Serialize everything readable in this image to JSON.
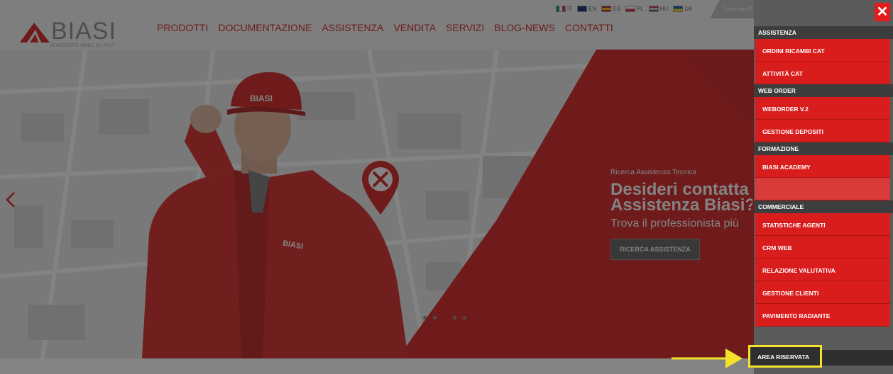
{
  "colors": {
    "brand_red": "#d21a1a",
    "menu_red": "#d91c1c",
    "section_header": "#3d3d3d",
    "highlight": "#f2e22a"
  },
  "header": {
    "logo_text": "BIASI",
    "logo_tagline": "BENESSERE MADE IN ITALY",
    "nav": [
      "PRODOTTI",
      "DOCUMENTAZIONE",
      "ASSISTENZA",
      "VENDITA",
      "SERVIZI",
      "BLOG-NEWS",
      "CONTATTI"
    ],
    "languages": [
      {
        "code": "IT",
        "colors": [
          "#009246",
          "#ffffff",
          "#ce2b37"
        ]
      },
      {
        "code": "EN",
        "colors": [
          "#012169",
          "#ffffff",
          "#c8102e"
        ]
      },
      {
        "code": "ES",
        "colors": [
          "#aa151b",
          "#f1bf00",
          "#aa151b"
        ]
      },
      {
        "code": "PL",
        "colors": [
          "#ffffff",
          "#dc143c"
        ]
      },
      {
        "code": "HU",
        "colors": [
          "#ce2939",
          "#ffffff",
          "#477050"
        ]
      },
      {
        "code": "UA",
        "colors": [
          "#0057b7",
          "#ffd700"
        ]
      }
    ],
    "sezione_label": "Sezione R"
  },
  "hero": {
    "kicker": "Ricerca Assistenza Tecnica",
    "title_line1": "Desideri contatta",
    "title_line2": "Assistenza Biasi?",
    "subtitle": "Trova il professionista più",
    "button": "RICERCA ASSISTENZA",
    "cap_text": "BIASI",
    "jacket_text": "BIASI",
    "slides": 5,
    "active_slide": 3
  },
  "side_menu": {
    "close_icon": "close-icon",
    "sections": [
      {
        "title": "ASSISTENZA",
        "items": [
          "ORDINI RICAMBI CAT",
          "ATTIVITÀ CAT"
        ]
      },
      {
        "title": "WEB ORDER",
        "items": [
          "WEBORDER V.2",
          "GESTIONE DEPOSITI"
        ]
      },
      {
        "title": "FORMAZIONE",
        "items": [
          "BIASI ACADEMY",
          ""
        ]
      },
      {
        "title": "COMMERCIALE",
        "items": [
          "STATISTICHE AGENTI",
          "CRM WEB",
          "RELAZIONE VALUTATIVA",
          "GESTIONE CLIENTI",
          "PAVIMENTO RADIANTE"
        ]
      }
    ],
    "area_riservata": "AREA RISERVATA"
  }
}
